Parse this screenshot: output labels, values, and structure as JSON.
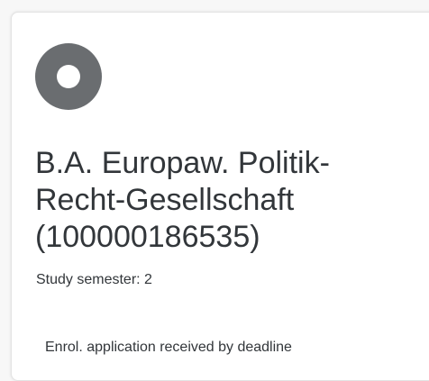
{
  "card": {
    "icon": "status-circle-icon",
    "title_lines": [
      "B.A. Europaw. Politik-",
      "Recht-Gesellschaft",
      "(100000186535)"
    ],
    "semester_text": "Study semester: 2",
    "status_text": "Enrol. application received by deadline"
  },
  "colors": {
    "icon": "#6a6d70",
    "text": "#32363a",
    "card_background": "#ffffff"
  }
}
